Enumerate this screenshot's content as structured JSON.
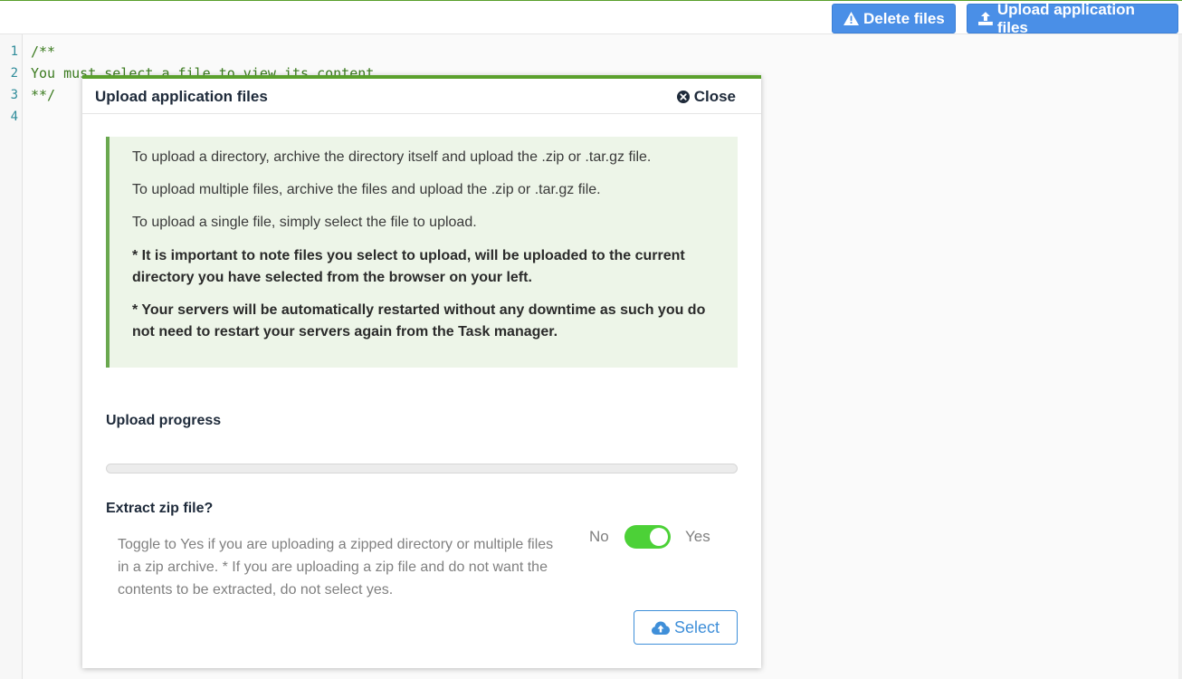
{
  "toolbar": {
    "delete_label": "Delete files",
    "upload_label": "Upload application files"
  },
  "editor": {
    "line_numbers": [
      "1",
      "2",
      "3",
      "4"
    ],
    "lines": [
      "/**",
      "You must select a file to view its content",
      "**/",
      ""
    ]
  },
  "modal": {
    "title": "Upload application files",
    "close_label": "Close",
    "info": [
      "To upload a directory, archive the directory itself and upload the .zip or .tar.gz file.",
      "To upload multiple files, archive the files and upload the .zip or .tar.gz file.",
      "To upload a single file, simply select the file to upload.",
      "* It is important to note files you select to upload, will be uploaded to the current directory you have selected from the browser on your left.",
      "* Your servers will be automatically restarted without any downtime as such you do not need to restart your servers again from the Task manager."
    ],
    "progress_label": "Upload progress",
    "progress_value": 0,
    "extract_label": "Extract zip file?",
    "extract_help": "Toggle to Yes if you are uploading a zipped directory or multiple files in a zip archive. * If you are uploading a zip file and do not want the contents to be extracted, do not select yes.",
    "toggle_no": "No",
    "toggle_yes": "Yes",
    "toggle_on": true,
    "select_label": "Select"
  },
  "colors": {
    "accent_green": "#5aa02c",
    "button_blue": "#4a8fe7",
    "toggle_green": "#4cd137"
  },
  "icons": [
    "warning-icon",
    "upload-icon",
    "close-circle-icon",
    "cloud-upload-icon"
  ]
}
